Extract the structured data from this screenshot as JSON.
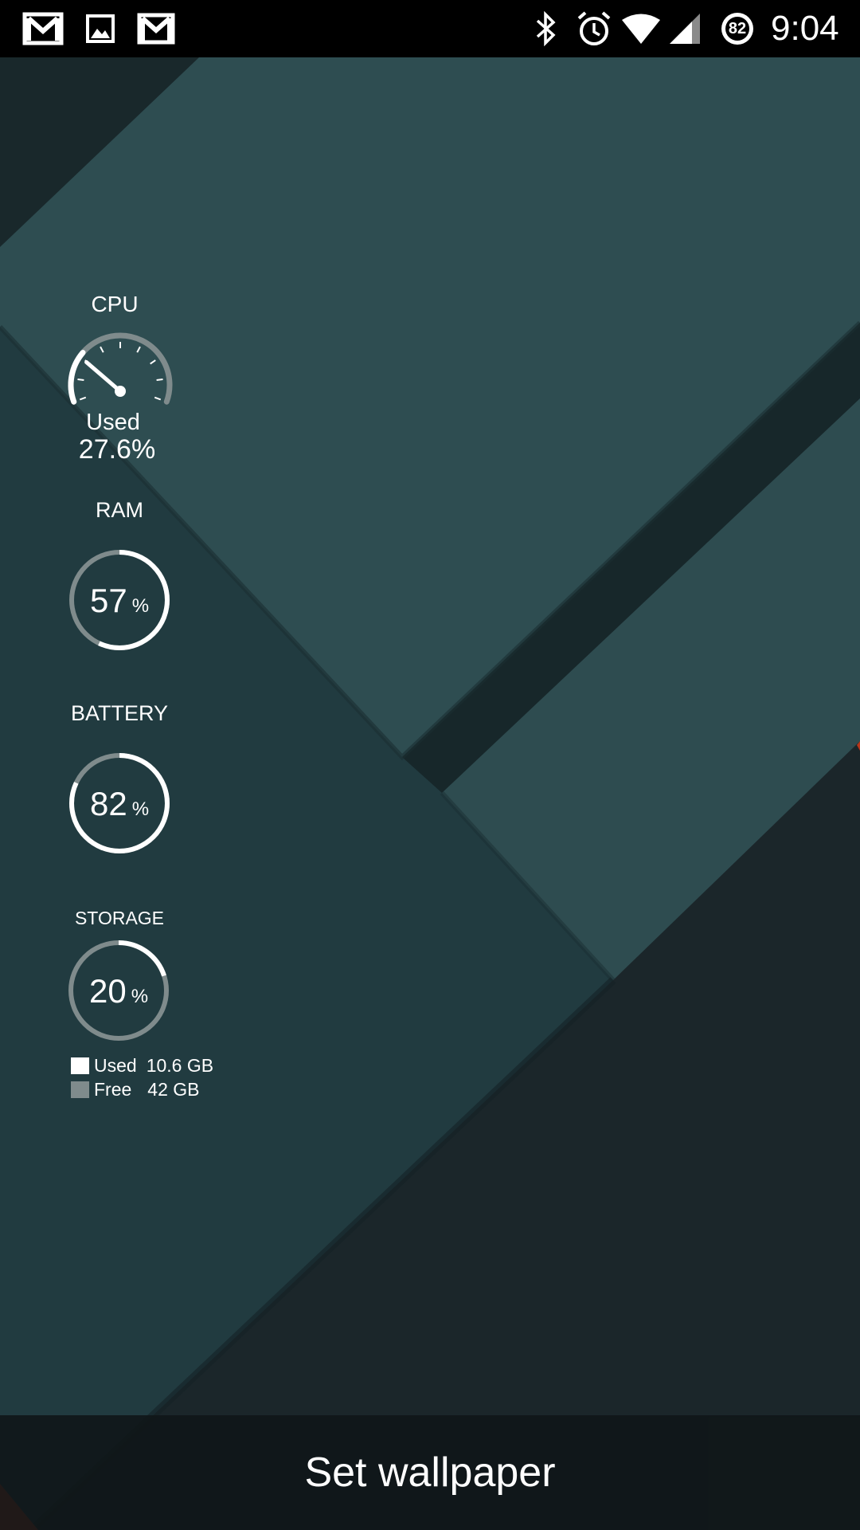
{
  "status_bar": {
    "left_icons": [
      "gmail-icon",
      "gallery-image-icon",
      "gmail-icon"
    ],
    "right_icons": [
      "bluetooth-icon",
      "alarm-icon",
      "wifi-icon",
      "cellular-signal-icon"
    ],
    "battery_level": "82",
    "time": "9:04"
  },
  "widgets": {
    "cpu": {
      "label": "CPU",
      "sub_label": "Used",
      "value_text": "27.6%",
      "value": 27.6
    },
    "ram": {
      "label": "RAM",
      "value": "57",
      "unit": "%"
    },
    "battery": {
      "label": "BATTERY",
      "value": "82",
      "unit": "%"
    },
    "storage": {
      "label": "STORAGE",
      "value": "20",
      "unit": "%",
      "legend": [
        {
          "label": "Used",
          "value": "10.6 GB",
          "color": "#ffffff"
        },
        {
          "label": "Free",
          "value": "42 GB",
          "color": "#7f8b8c"
        }
      ]
    }
  },
  "colors": {
    "ring_fill": "#ffffff",
    "ring_track": "#7f8b8c",
    "accent_red": "#b8361a"
  },
  "bottom_bar": {
    "label": "Set wallpaper"
  }
}
